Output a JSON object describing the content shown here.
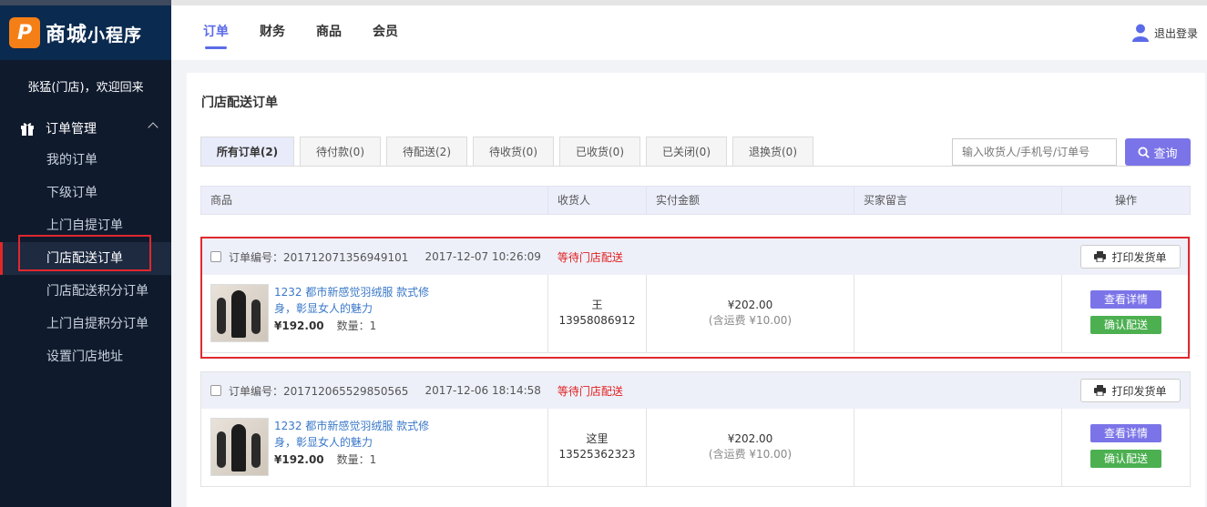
{
  "brand": {
    "logo_glyph": "P",
    "name_main": "商城",
    "name_sub": "小程序"
  },
  "sidebar": {
    "welcome": "张猛(门店)，欢迎回来",
    "group_label": "订单管理",
    "items": [
      {
        "label": "我的订单"
      },
      {
        "label": "下级订单"
      },
      {
        "label": "上门自提订单"
      },
      {
        "label": "门店配送订单"
      },
      {
        "label": "门店配送积分订单"
      },
      {
        "label": "上门自提积分订单"
      },
      {
        "label": "设置门店地址"
      }
    ]
  },
  "topnav": {
    "items": [
      {
        "label": "订单"
      },
      {
        "label": "财务"
      },
      {
        "label": "商品"
      },
      {
        "label": "会员"
      }
    ],
    "logout": "退出登录"
  },
  "page": {
    "title": "门店配送订单"
  },
  "tabs": [
    {
      "label": "所有订单(2)"
    },
    {
      "label": "待付款(0)"
    },
    {
      "label": "待配送(2)"
    },
    {
      "label": "待收货(0)"
    },
    {
      "label": "已收货(0)"
    },
    {
      "label": "已关闭(0)"
    },
    {
      "label": "退换货(0)"
    }
  ],
  "search": {
    "placeholder": "输入收货人/手机号/订单号",
    "button": "查询"
  },
  "table": {
    "headers": [
      "商品",
      "收货人",
      "实付金额",
      "买家留言",
      "操作"
    ]
  },
  "orders": [
    {
      "order_no": "订单编号：201712071356949101",
      "time": "2017-12-07 10:26:09",
      "status": "等待门店配送",
      "print": "打印发货单",
      "goods_name": "1232 都市新感觉羽绒服 款式修身，彰显女人的魅力",
      "price": "¥192.00",
      "qty": "数量：1",
      "receiver": "王",
      "phone": "13958086912",
      "amount": "¥202.00",
      "shipping": "(含运费 ¥10.00)",
      "view": "查看详情",
      "confirm": "确认配送"
    },
    {
      "order_no": "订单编号：201712065529850565",
      "time": "2017-12-06 18:14:58",
      "status": "等待门店配送",
      "print": "打印发货单",
      "goods_name": "1232 都市新感觉羽绒服 款式修身，彰显女人的魅力",
      "price": "¥192.00",
      "qty": "数量：1",
      "receiver": "这里",
      "phone": "13525362323",
      "amount": "¥202.00",
      "shipping": "(含运费 ¥10.00)",
      "view": "查看详情",
      "confirm": "确认配送"
    }
  ]
}
